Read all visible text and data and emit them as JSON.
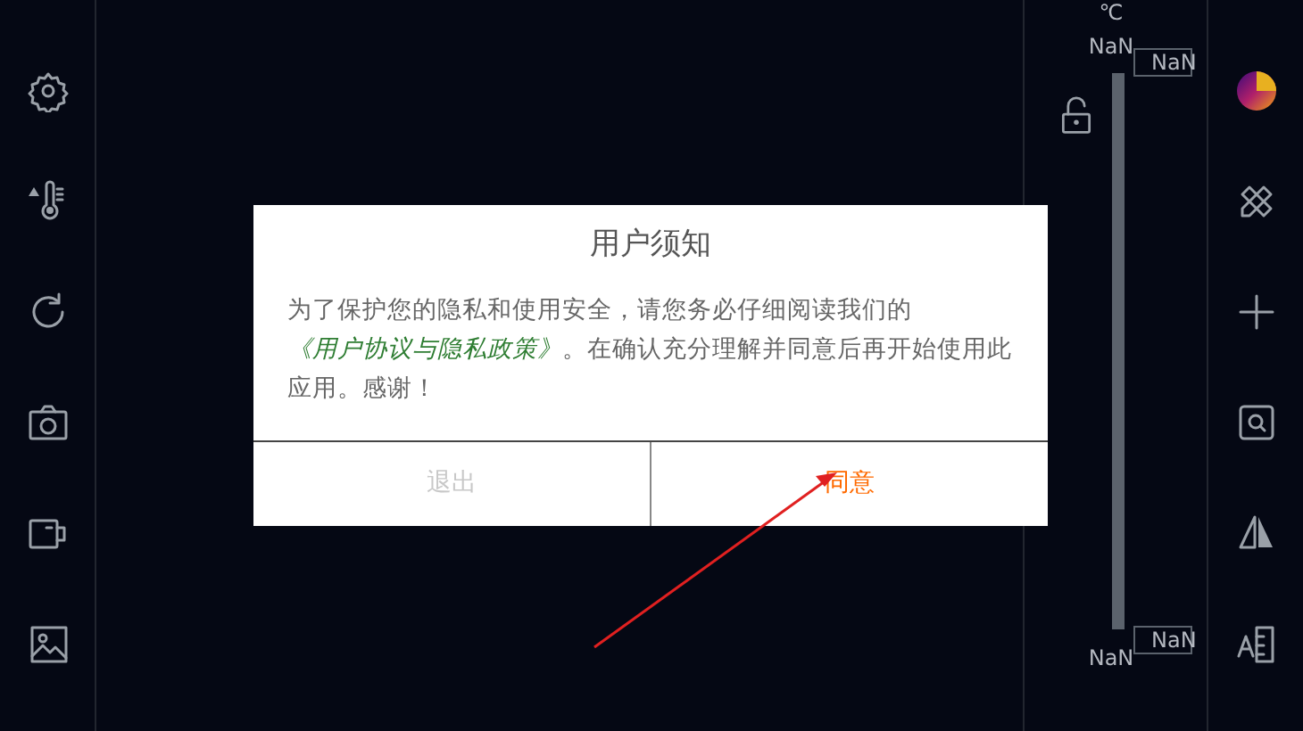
{
  "scale": {
    "unit": "℃",
    "top_reading": "NaN",
    "upper_marker": "NaN",
    "lower_marker": "NaN",
    "bottom_reading": "NaN",
    "locked": false
  },
  "dialog": {
    "title": "用户须知",
    "message": {
      "before": "为了保护您的隐私和使用安全，请您务必仔细阅读我们的",
      "link": "《用户协议与隐私政策》",
      "after": "。在确认充分理解并同意后再开始使用此应用。感谢！"
    },
    "buttons": [
      {
        "label": "退出",
        "kind": "cancel"
      },
      {
        "label": "同意",
        "kind": "confirm"
      }
    ]
  }
}
